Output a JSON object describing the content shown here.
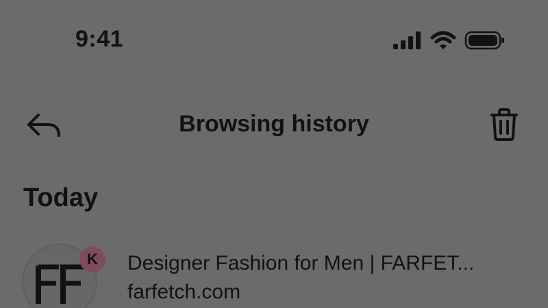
{
  "status_bar": {
    "time": "9:41",
    "icons": [
      "cellular-signal-icon",
      "wifi-icon",
      "battery-icon"
    ]
  },
  "header": {
    "title": "Browsing history",
    "back_icon": "back-arrow-icon",
    "delete_icon": "trash-icon"
  },
  "sections": [
    {
      "title": "Today",
      "items": [
        {
          "title": "Designer Fashion for Men | FARFET...",
          "url": "farfetch.com",
          "favicon": "farfetch-logo-icon",
          "account_badge": "K"
        }
      ]
    }
  ],
  "colors": {
    "background": "#6b6b6b",
    "text": "#121212",
    "badge": "#7d4d5d"
  }
}
